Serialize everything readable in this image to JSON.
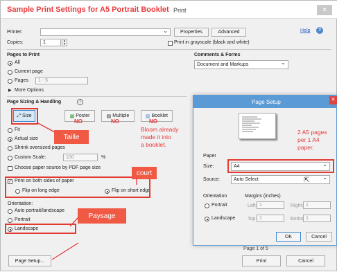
{
  "dialog": {
    "title": "Sample Print Settings for A5 Portrait Booklet",
    "subtitle": "Print",
    "help_link": "Help",
    "printer_label": "Printer:",
    "properties_btn": "Properties",
    "advanced_btn": "Advanced",
    "copies_label": "Copies:",
    "copies_value": "1",
    "grayscale_label": "Print in grayscale (black and white)",
    "pages_to_print": {
      "heading": "Pages to Print",
      "all": "All",
      "current": "Current page",
      "pages": "Pages",
      "pages_value": "1 - 5",
      "more": "More Options"
    },
    "comments_forms": {
      "heading": "Comments & Forms",
      "value": "Document and Markups"
    },
    "sizing": {
      "heading": "Page Sizing & Handling",
      "size_btn": "Size",
      "poster_btn": "Poster",
      "multiple_btn": "Multiple",
      "booklet_btn": "Booklet",
      "fit": "Fit",
      "actual": "Actual size",
      "shrink": "Shrink oversized pages",
      "custom": "Custom Scale:",
      "custom_value": "100",
      "percent": "%",
      "paper_source": "Choose paper source by PDF page size"
    },
    "duplex": {
      "label": "Print on both sides of paper",
      "long": "Flip on long edge",
      "short": "Flip on short edge"
    },
    "orientation": {
      "heading": "Orientation:",
      "auto": "Auto portrait/landscape",
      "portrait": "Portrait",
      "landscape": "Landscape"
    },
    "page_setup_btn": "Page Setup...",
    "print_btn": "Print",
    "cancel_btn": "Cancel",
    "pages_label": "Page 1 of 5"
  },
  "page_setup": {
    "title": "Page Setup",
    "paper_heading": "Paper",
    "size_label": "Size:",
    "size_value": "A4",
    "source_label": "Source:",
    "source_value": "Auto Select",
    "orientation_heading": "Orientation",
    "portrait": "Portrait",
    "landscape": "Landscape",
    "margins_heading": "Margins (inches)",
    "left": "Left:",
    "left_val": "1",
    "right": "Right:",
    "right_val": "1",
    "top": "Top:",
    "top_val": "1",
    "bottom": "Bottom:",
    "bottom_val": "1",
    "ok": "OK",
    "cancel": "Cancel"
  },
  "annotations": {
    "taille": "Taille",
    "court": "court",
    "paysage": "Paysage",
    "no1": "NO",
    "no2": "NO",
    "no3": "NO",
    "bloom": [
      "Bloom already",
      "made it into",
      "a booklet."
    ],
    "a5": [
      "2 A5 pages",
      "per 1 A4",
      "paper."
    ]
  },
  "colors": {
    "accent": "#e8373a",
    "callout": "#f05a45",
    "title_blue": "#4d88c9"
  }
}
